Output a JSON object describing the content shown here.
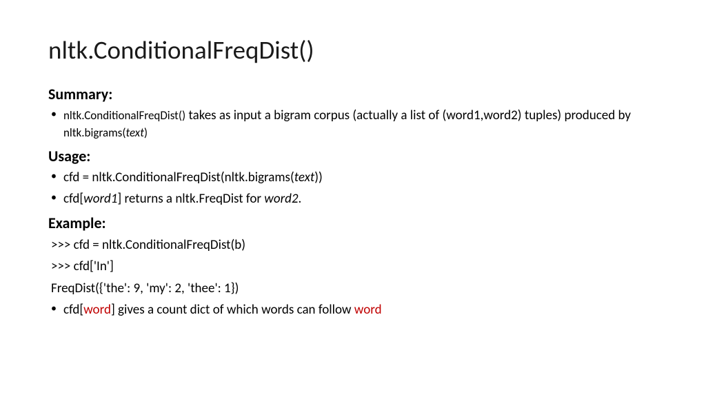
{
  "title": "nltk.ConditionalFreqDist()",
  "sections": {
    "summary": {
      "heading": "Summary:",
      "bullet": {
        "code1": "nltk.ConditionalFreqDist()",
        "text1": " takes as input a bigram corpus (actually a list of (word1,word2) tuples) produced by ",
        "code2": "nltk.bigrams(",
        "arg": "text",
        "code3": ")"
      }
    },
    "usage": {
      "heading": "Usage:",
      "bullet1": {
        "text1": "cfd = nltk.ConditionalFreqDist(nltk.bigrams(",
        "arg": "text",
        "text2": "))"
      },
      "bullet2": {
        "text1": "cfd[",
        "arg1": "word1",
        "text2": "] returns a nltk.FreqDist for ",
        "arg2": "word2",
        "text3": "."
      }
    },
    "example": {
      "heading": "Example:",
      "line1": ">>> cfd = nltk.ConditionalFreqDist(b)",
      "line2": ">>> cfd['In']",
      "line3": "FreqDist({'the': 9, 'my': 2, 'thee': 1})",
      "bullet": {
        "text1": "cfd[",
        "red1": "word",
        "text2": "] gives a count dict of which words can follow ",
        "red2": "word"
      }
    }
  }
}
